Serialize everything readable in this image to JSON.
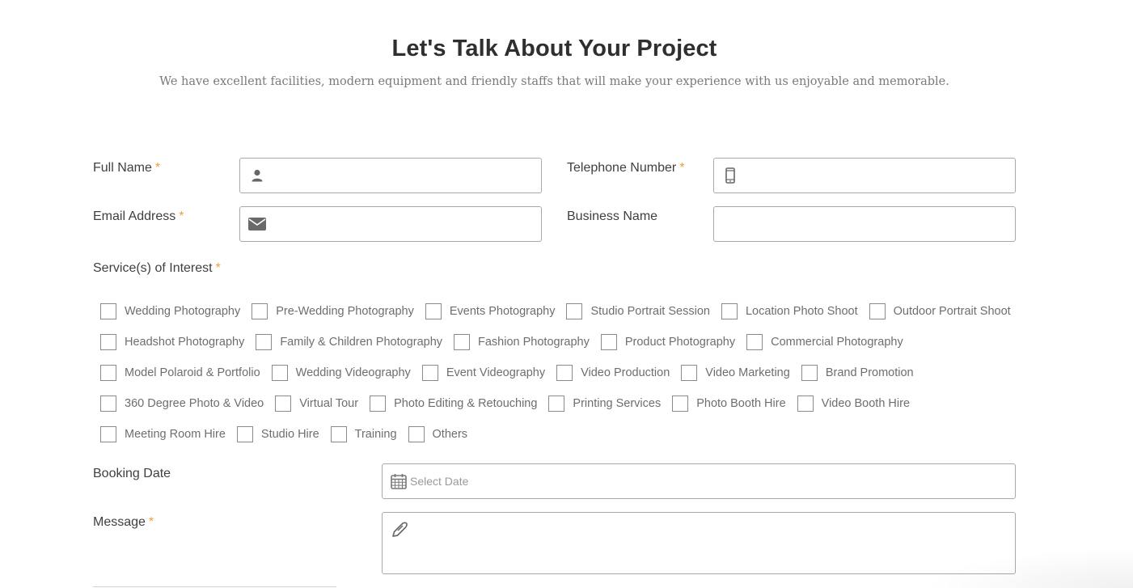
{
  "header": {
    "title": "Let's Talk About Your Project",
    "subtitle": "We have excellent facilities, modern equipment and friendly staffs that will make your experience with us enjoyable and memorable."
  },
  "form": {
    "required_mark": "*",
    "full_name": {
      "label": "Full Name",
      "icon": "user-icon",
      "value": ""
    },
    "telephone": {
      "label": "Telephone Number",
      "icon": "mobile-phone-icon",
      "value": ""
    },
    "email": {
      "label": "Email Address",
      "icon": "envelope-icon",
      "value": ""
    },
    "business": {
      "label": "Business Name",
      "value": ""
    },
    "services": {
      "label": "Service(s) of Interest",
      "rows": [
        [
          "Wedding Photography",
          "Pre-Wedding Photography",
          "Events Photography",
          "Studio Portrait Session",
          "Location Photo Shoot",
          "Outdoor Portrait Shoot"
        ],
        [
          "Headshot Photography",
          "Family & Children Photography",
          "Fashion Photography",
          "Product Photography",
          "Commercial Photography"
        ],
        [
          "Model Polaroid & Portfolio",
          "Wedding Videography",
          "Event Videography",
          "Video Production",
          "Video Marketing",
          "Brand Promotion"
        ],
        [
          "360 Degree Photo & Video",
          "Virtual Tour",
          "Photo Editing & Retouching",
          "Printing Services",
          "Photo Booth Hire",
          "Video Booth Hire"
        ],
        [
          "Meeting Room Hire",
          "Studio Hire",
          "Training",
          "Others"
        ]
      ]
    },
    "booking_date": {
      "label": "Booking Date",
      "placeholder": "Select Date",
      "icon": "calendar-icon"
    },
    "message": {
      "label": "Message",
      "icon": "pen-icon",
      "value": ""
    }
  },
  "colors": {
    "required": "#e8a13a",
    "border": "#a9a9a9",
    "label": "#3f3f3f",
    "option_text": "#6e6e6e"
  }
}
